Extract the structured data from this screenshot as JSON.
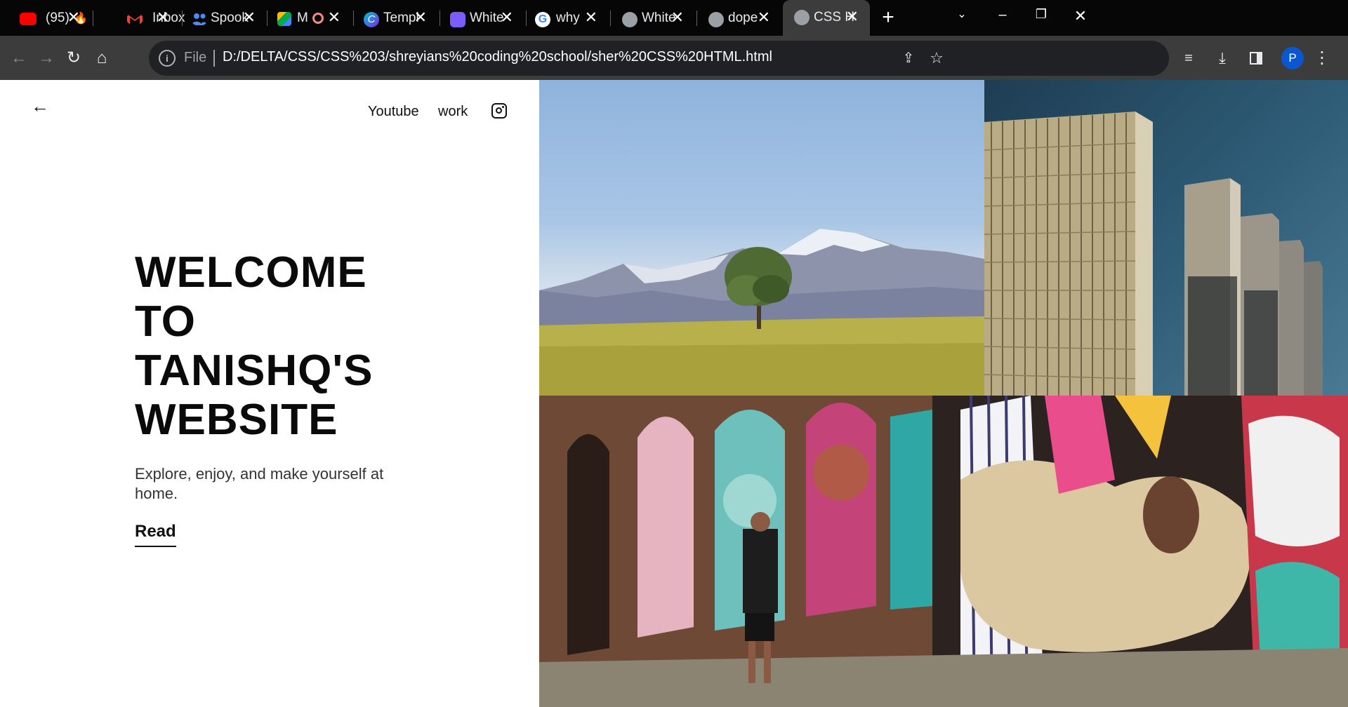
{
  "browser": {
    "tabs": [
      {
        "title": "(95)",
        "favicon": "youtube-icon",
        "color": "#ff0000",
        "active": false
      },
      {
        "title": "Inbox",
        "favicon": "gmail-icon",
        "color": "#ea4335",
        "active": false
      },
      {
        "title": "Spook",
        "favicon": "people-icon",
        "color": "#4c8bf5",
        "active": false
      },
      {
        "title": "M",
        "favicon": "meet-icon",
        "color": "#00ac47",
        "active": false
      },
      {
        "title": "Templ",
        "favicon": "canva-icon",
        "color": "#00c4cc",
        "active": false
      },
      {
        "title": "White",
        "favicon": "whiteboard-icon",
        "color": "#7b5cff",
        "active": false
      },
      {
        "title": "why n",
        "favicon": "google-icon",
        "color": "#ffffff",
        "active": false
      },
      {
        "title": "White",
        "favicon": "globe-icon",
        "color": "#9aa0a6",
        "active": false
      },
      {
        "title": "dope",
        "favicon": "globe-icon",
        "color": "#9aa0a6",
        "active": false
      },
      {
        "title": "CSS H",
        "favicon": "globe-icon",
        "color": "#9aa0a6",
        "active": true
      }
    ],
    "new_tab_label": "+",
    "address": {
      "scheme": "File",
      "url": "D:/DELTA/CSS/CSS%203/shreyians%20coding%20school/sher%20CSS%20HTML.html"
    },
    "profile_initial": "P"
  },
  "page": {
    "nav": {
      "links": [
        "Youtube",
        "work"
      ]
    },
    "hero": {
      "title": "WELCOME TO TANISHQ'S WEBSITE",
      "subtitle": "Explore, enjoy, and make yourself at home.",
      "cta": "Read"
    }
  }
}
